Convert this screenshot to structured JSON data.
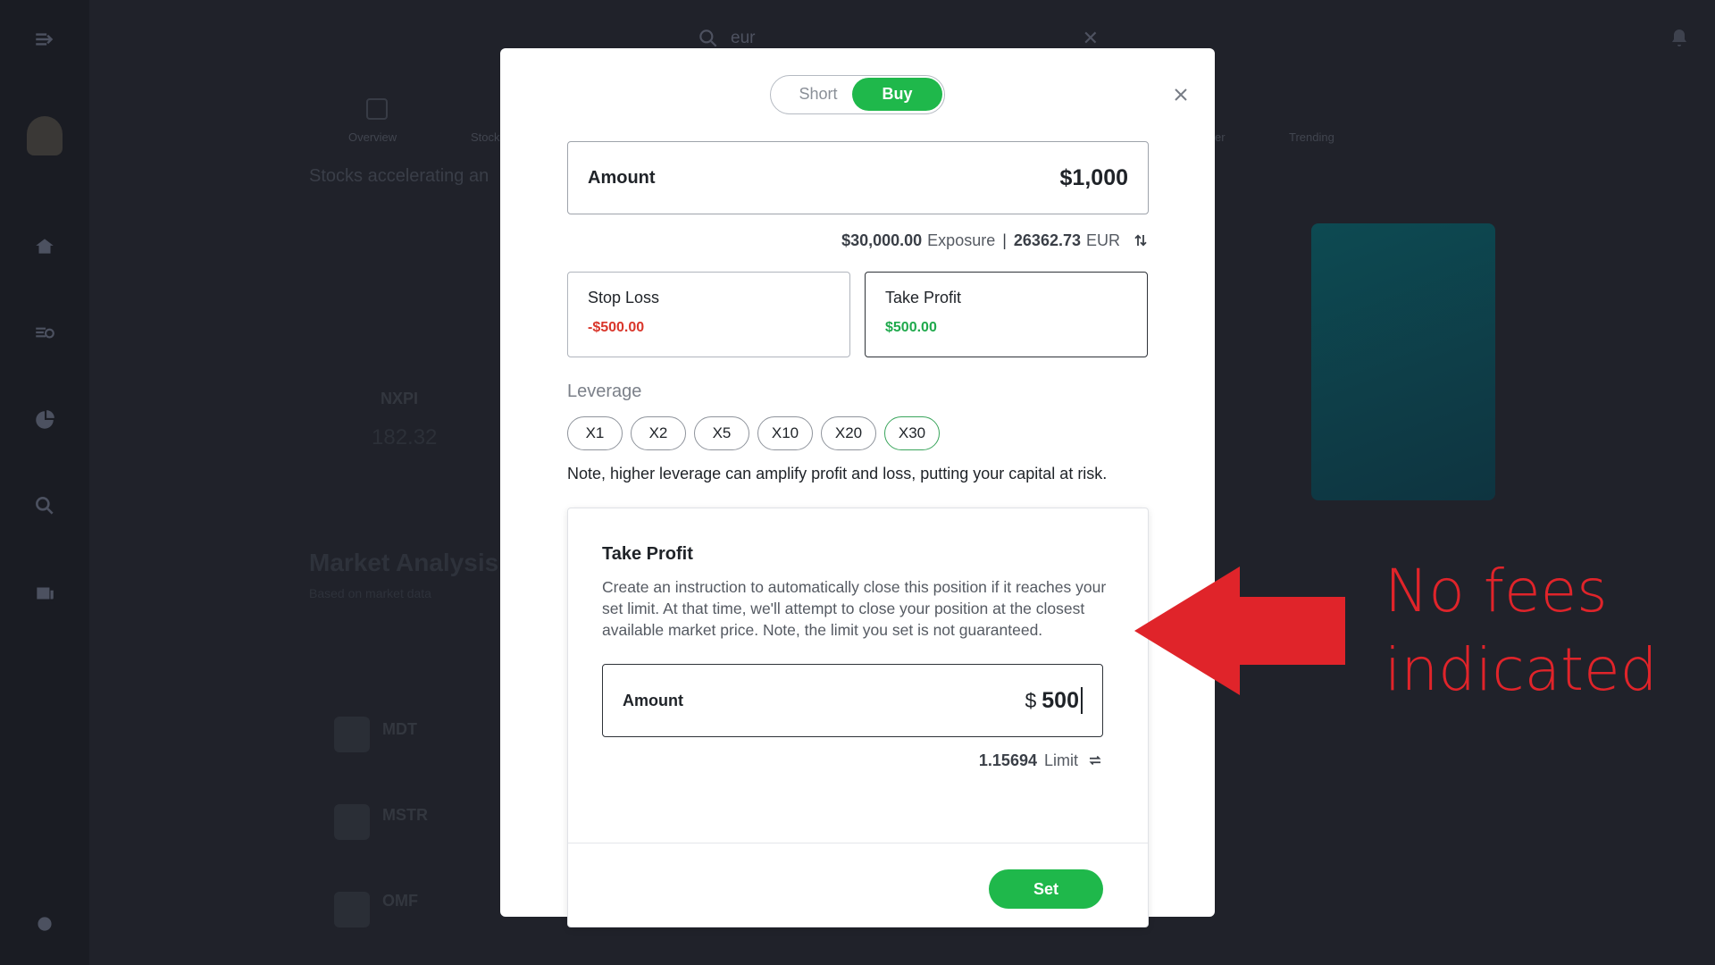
{
  "background": {
    "search_value": "eur",
    "tabs": [
      "Overview",
      "Stocks",
      "er",
      "Trending"
    ],
    "subtitle": "Stocks accelerating an",
    "heading": "Market Analysis",
    "heading_sub": "Based on market data",
    "tickers": [
      "NXPI",
      "MDT",
      "MSTR",
      "OMF"
    ],
    "price": "182.32"
  },
  "modal": {
    "toggle": {
      "short_label": "Short",
      "buy_label": "Buy",
      "selected": "Buy"
    },
    "amount": {
      "label": "Amount",
      "value": "$1,000"
    },
    "exposure": {
      "value": "$30,000.00",
      "label": "Exposure",
      "separator": "|",
      "converted": "26362.73",
      "currency": "EUR"
    },
    "stop_loss": {
      "label": "Stop Loss",
      "value": "-$500.00"
    },
    "take_profit": {
      "label": "Take Profit",
      "value": "$500.00"
    },
    "leverage": {
      "label": "Leverage",
      "options": [
        "X1",
        "X2",
        "X5",
        "X10",
        "X20",
        "X30"
      ],
      "selected": "X30",
      "note": "Note, higher leverage can amplify profit and loss, putting your capital at risk."
    },
    "tp_panel": {
      "title": "Take Profit",
      "description": "Create an instruction to automatically close this position if it reaches your set limit. At that time, we'll attempt to close your position at the closest available market price. Note, the limit you set is not guaranteed.",
      "input_label": "Amount",
      "currency_symbol": "$",
      "input_value": "500",
      "limit_value": "1.15694",
      "limit_label": "Limit",
      "set_label": "Set"
    }
  },
  "annotation": {
    "line1": "No fees",
    "line2": "indicated",
    "color": "#e0242a"
  },
  "colors": {
    "accent_green": "#1fb84b",
    "loss_red": "#d9362b",
    "profit_green": "#1fa94c"
  }
}
